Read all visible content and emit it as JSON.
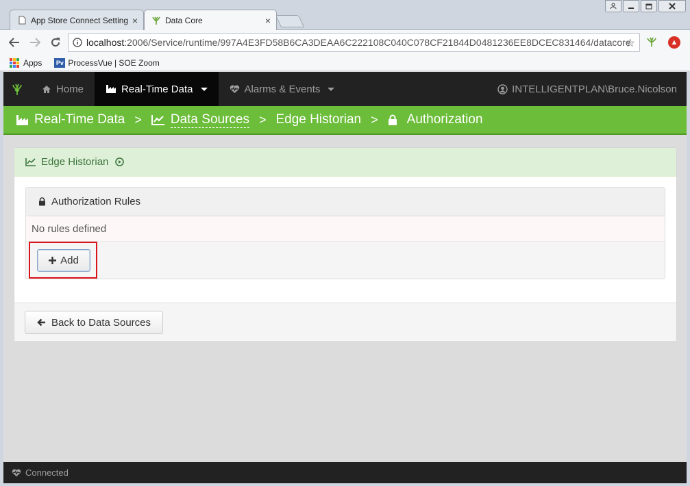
{
  "browser": {
    "tabs": [
      {
        "title": "App Store Connect Settings",
        "close": "×"
      },
      {
        "title": "Data Core",
        "close": "×"
      }
    ],
    "url_host": "localhost",
    "url_path": ":2006/Service/runtime/997A4E3FD58B6CA3DEAA6C222108C040C078CF21844D0481236EE8DCEC831464/datacore",
    "bookmarks": [
      {
        "label": "Apps"
      },
      {
        "label": "ProcessVue | SOE Zoom",
        "icon_text": "Pv"
      }
    ]
  },
  "navbar": {
    "items": [
      {
        "label": "Home",
        "icon": "home-icon"
      },
      {
        "label": "Real-Time Data",
        "icon": "industry-icon"
      },
      {
        "label": "Alarms & Events",
        "icon": "heartbeat-icon"
      }
    ],
    "user": "INTELLIGENTPLAN\\Bruce.Nicolson"
  },
  "breadcrumb": {
    "items": [
      {
        "label": "Real-Time Data"
      },
      {
        "label": "Data Sources"
      },
      {
        "label": "Edge Historian"
      },
      {
        "label": "Authorization"
      }
    ],
    "separator": ">"
  },
  "panel": {
    "title": "Edge Historian",
    "rules_title": "Authorization Rules",
    "empty_text": "No rules defined",
    "add_label": "Add",
    "back_label": "Back to Data Sources"
  },
  "footer": {
    "status": "Connected"
  },
  "colors": {
    "brand_green": "#6cbd3a",
    "navbar": "#222222",
    "highlight": "#d9121b"
  }
}
